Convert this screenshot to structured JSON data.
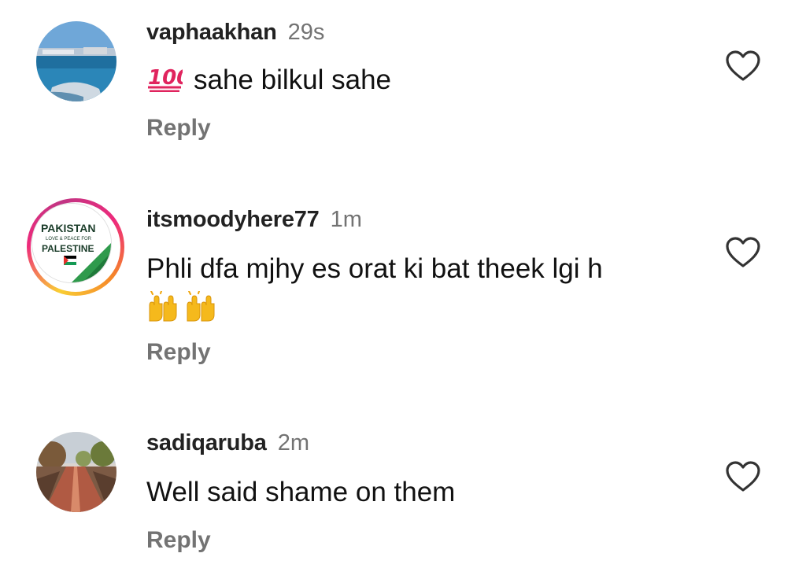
{
  "comments": [
    {
      "username": "vaphaakhan",
      "time": "29s",
      "emoji": "100-emoji",
      "text": "sahe bilkul sahe",
      "reply_label": "Reply",
      "avatar": "avatar-sea-photo",
      "like_icon": "heart-outline-icon"
    },
    {
      "username": "itsmoodyhere77",
      "time": "1m",
      "text": "Phli dfa mjhy es orat ki bat theek lgi h",
      "emoji_line": "raising-hands-emoji x2",
      "reply_label": "Reply",
      "avatar": "avatar-pakistan-palestine",
      "avatar_text": {
        "line1": "PAKISTAN",
        "line2": "LOVE & PEACE FOR",
        "line3": "PALESTINE"
      },
      "story_ring_colors": [
        "#f9ce34",
        "#ee2a7b",
        "#c13584",
        "#f58529"
      ],
      "like_icon": "heart-outline-icon"
    },
    {
      "username": "sadiqaruba",
      "time": "2m",
      "text": "Well said shame on them",
      "reply_label": "Reply",
      "avatar": "avatar-park-path",
      "like_icon": "heart-outline-icon"
    }
  ],
  "colors": {
    "username": "#222222",
    "secondary": "#737373",
    "text": "#111111",
    "background": "#ffffff"
  }
}
